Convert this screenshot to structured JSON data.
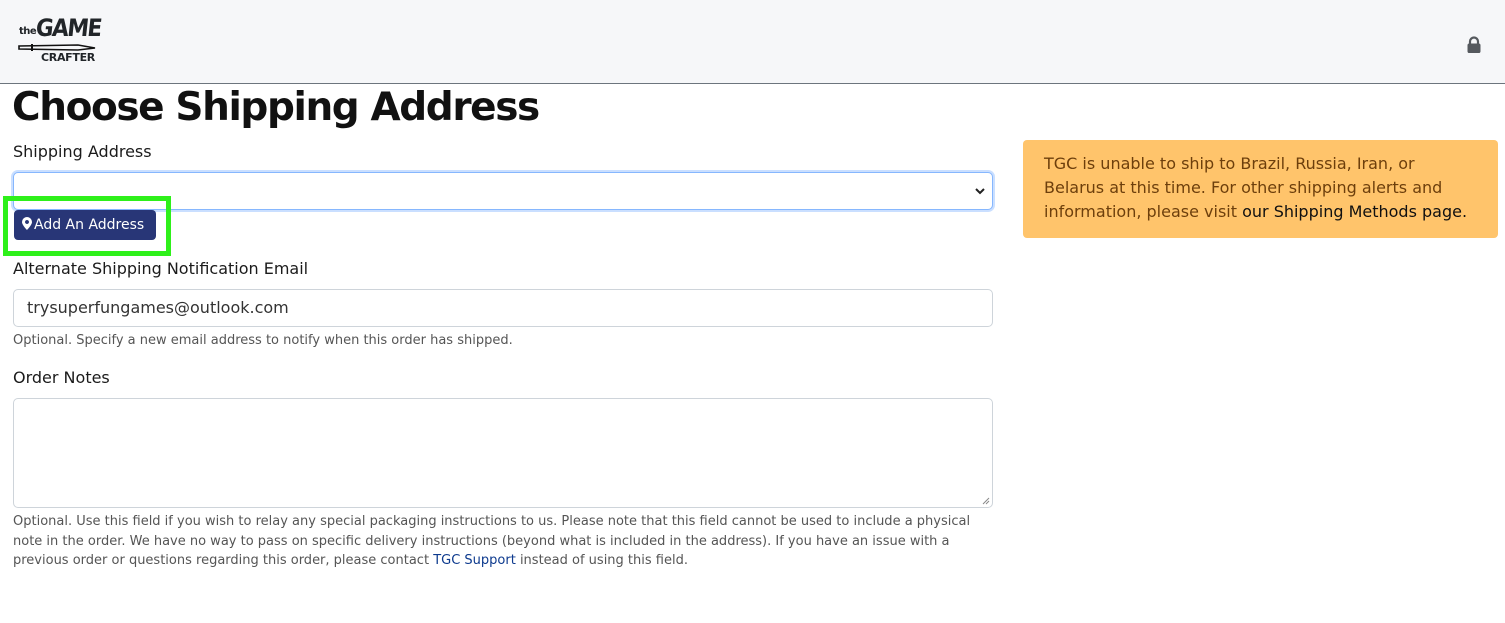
{
  "header": {
    "logo": {
      "line1": "the",
      "line2": "GAME",
      "line3": "CRAFTER"
    },
    "lock_icon": "lock-icon"
  },
  "main": {
    "title": "Choose Shipping Address",
    "shipping_address": {
      "label": "Shipping Address",
      "selected_value": "",
      "add_button_label": "Add An Address",
      "add_button_icon": "map-pin-icon"
    },
    "alt_email": {
      "label": "Alternate Shipping Notification Email",
      "value": "trysuperfungames@outlook.com",
      "help": "Optional. Specify a new email address to notify when this order has shipped."
    },
    "order_notes": {
      "label": "Order Notes",
      "value": "",
      "help_before_link": "Optional. Use this field if you wish to relay any special packaging instructions to us. Please note that this field cannot be used to include a physical note in the order. We have no way to pass on specific delivery instructions (beyond what is included in the address). If you have an issue with a previous order or questions regarding this order, please contact ",
      "help_link": "TGC Support",
      "help_after_link": " instead of using this field."
    }
  },
  "alert": {
    "text": "TGC is unable to ship to Brazil, Russia, Iran, or Belarus at this time. For other shipping alerts and information, please visit ",
    "link": "our Shipping Methods page."
  },
  "colors": {
    "topbar_bg": "#f6f7f9",
    "button_bg": "#283677",
    "highlight": "#2ef01a",
    "alert_bg": "#ffc46b",
    "alert_text": "#6d3f0c",
    "link": "#0d3a8e"
  }
}
